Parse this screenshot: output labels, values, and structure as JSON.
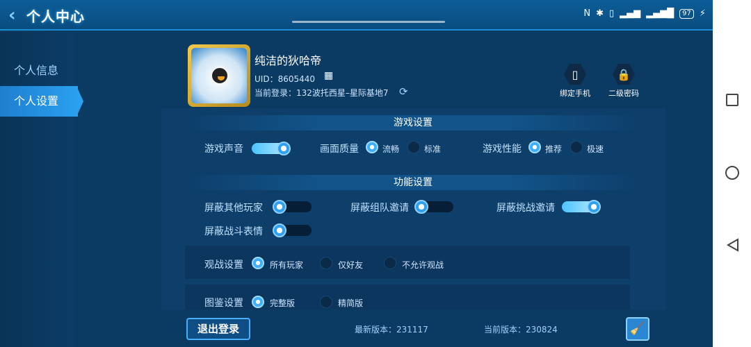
{
  "header": {
    "title": "个人中心"
  },
  "status_bar": {
    "battery": "97",
    "icons": [
      "nfc-icon",
      "bluetooth-icon",
      "vibrate-icon",
      "wifi-icon",
      "signal-icon",
      "battery-icon",
      "charging-icon"
    ]
  },
  "sidebar": {
    "items": [
      {
        "label": "个人信息",
        "active": false
      },
      {
        "label": "个人设置",
        "active": true
      }
    ]
  },
  "profile": {
    "name": "纯洁的狄哈帝",
    "uid": "UID：8605440",
    "current_login": "当前登录：132波托西星–星际基地7",
    "actions": [
      {
        "label": "绑定手机",
        "icon": "phone-icon"
      },
      {
        "label": "二级密码",
        "icon": "lock-icon"
      }
    ]
  },
  "game_settings": {
    "title": "游戏设置",
    "sound": {
      "label": "游戏声音",
      "on": true
    },
    "quality": {
      "label": "画面质量",
      "options": [
        "流畅",
        "标准"
      ],
      "selected": "流畅"
    },
    "performance": {
      "label": "游戏性能",
      "options": [
        "推荐",
        "极速"
      ],
      "selected": "推荐"
    }
  },
  "function_settings": {
    "title": "功能设置",
    "toggles": [
      {
        "label": "屏蔽其他玩家",
        "on": false
      },
      {
        "label": "屏蔽组队邀请",
        "on": false
      },
      {
        "label": "屏蔽挑战邀请",
        "on": true
      },
      {
        "label": "屏蔽战斗表情",
        "on": false
      }
    ],
    "spectate": {
      "label": "观战设置",
      "options": [
        "所有玩家",
        "仅好友",
        "不允许观战"
      ],
      "selected": "所有玩家"
    },
    "gallery": {
      "label": "图鉴设置",
      "options": [
        "完整版",
        "精简版"
      ],
      "selected": "完整版"
    }
  },
  "footer": {
    "logout_label": "退出登录",
    "latest_version": "最新版本：231117",
    "current_version": "当前版本：230824"
  },
  "colors": {
    "accent": "#2aa0ef",
    "panel": "#0e3e6a",
    "background": "#0b3a63"
  }
}
